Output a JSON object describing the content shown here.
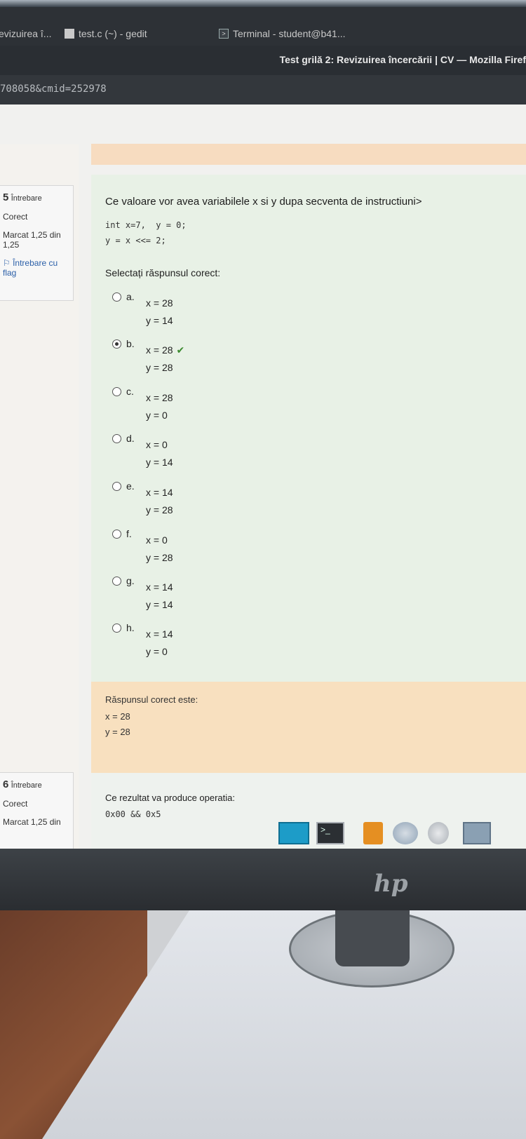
{
  "os_taskbar": {
    "tab1": "evizuirea î...",
    "tab2": "test.c (~) - gedit",
    "tab3": "Terminal - student@b41..."
  },
  "browser": {
    "title": "Test grilă 2: Revizuirea încercării | CV — Mozilla Firef",
    "url": "708058&cmid=252978"
  },
  "question5": {
    "number": "5",
    "label": "Întrebare",
    "status": "Corect",
    "marks": "Marcat 1,25 din 1,25",
    "flag": "Întrebare cu flag",
    "text": "Ce valoare vor avea variabilele x si y dupa secventa de instructiuni>",
    "code_line1": "int x=7,  y = 0;",
    "code_line2": "y = x <<= 2;",
    "prompt": "Selectați răspunsul corect:",
    "options": [
      {
        "letter": "a.",
        "x": "x = 28",
        "y": "y = 14",
        "selected": false,
        "correct": false
      },
      {
        "letter": "b.",
        "x": "x = 28",
        "y": "y = 28",
        "selected": true,
        "correct": true
      },
      {
        "letter": "c.",
        "x": "x = 28",
        "y": "y = 0",
        "selected": false,
        "correct": false
      },
      {
        "letter": "d.",
        "x": "x = 0",
        "y": "y = 14",
        "selected": false,
        "correct": false
      },
      {
        "letter": "e.",
        "x": "x = 14",
        "y": "y = 28",
        "selected": false,
        "correct": false
      },
      {
        "letter": "f.",
        "x": "x = 0",
        "y": "y = 28",
        "selected": false,
        "correct": false
      },
      {
        "letter": "g.",
        "x": "x = 14",
        "y": "y = 14",
        "selected": false,
        "correct": false
      },
      {
        "letter": "h.",
        "x": "x = 14",
        "y": "y = 0",
        "selected": false,
        "correct": false
      }
    ],
    "feedback_title": "Răspunsul corect este:",
    "feedback_x": "x = 28",
    "feedback_y": "y = 28"
  },
  "question6": {
    "number": "6",
    "label": "Întrebare",
    "status": "Corect",
    "marks": "Marcat 1,25 din",
    "text": "Ce rezultat va produce operatia:",
    "code_line1": "0x00 && 0x5"
  },
  "monitor_logo": "hp"
}
